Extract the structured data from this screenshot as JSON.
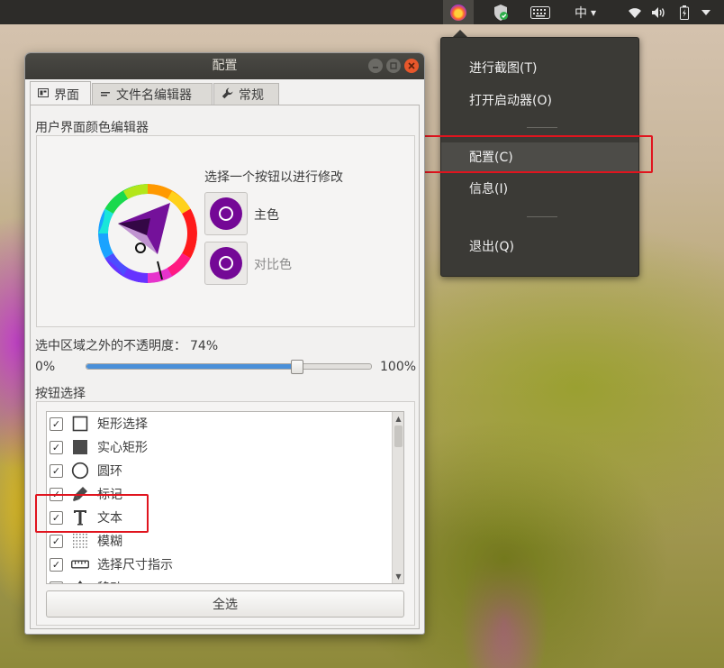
{
  "panel": {
    "ime_label": "中",
    "ime_arrow": "▾",
    "colors": {
      "bg": "#2d2c29",
      "indicator_bg": "#4a4843"
    }
  },
  "tray_menu": {
    "items": [
      {
        "label": "进行截图(T)"
      },
      {
        "label": "打开启动器(O)"
      },
      {
        "label": "配置(C)",
        "highlighted": true
      },
      {
        "label": "信息(I)"
      },
      {
        "label": "退出(Q)"
      }
    ]
  },
  "window": {
    "title": "配置",
    "tabs": [
      {
        "label": "界面",
        "icon": "interface-icon",
        "active": true
      },
      {
        "label": "文件名编辑器",
        "icon": "filename-editor-icon",
        "active": false
      },
      {
        "label": "常规",
        "icon": "wrench-icon",
        "active": false
      }
    ],
    "color_editor": {
      "group_label": "用户界面颜色编辑器",
      "prompt": "选择一个按钮以进行修改",
      "main_color_label": "主色",
      "contrast_color_label": "对比色",
      "swatch_color": "#740896"
    },
    "opacity": {
      "label": "选中区域之外的不透明度：",
      "value_label": "74%",
      "value": 74,
      "min_label": "0%",
      "max_label": "100%"
    },
    "buttons": {
      "group_label": "按钮选择",
      "items": [
        {
          "label": "矩形选择",
          "icon": "rectangle-outline-icon",
          "checked": true
        },
        {
          "label": "实心矩形",
          "icon": "filled-rectangle-icon",
          "checked": true
        },
        {
          "label": "圆环",
          "icon": "circle-icon",
          "checked": true
        },
        {
          "label": "标记",
          "icon": "marker-icon",
          "checked": true
        },
        {
          "label": "文本",
          "icon": "text-icon",
          "checked": true
        },
        {
          "label": "模糊",
          "icon": "blur-icon",
          "checked": true
        },
        {
          "label": "选择尺寸指示",
          "icon": "ruler-icon",
          "checked": true
        },
        {
          "label": "移动",
          "icon": "move-icon",
          "checked": true
        }
      ],
      "check_mark": "✓",
      "select_all_label": "全选"
    }
  }
}
